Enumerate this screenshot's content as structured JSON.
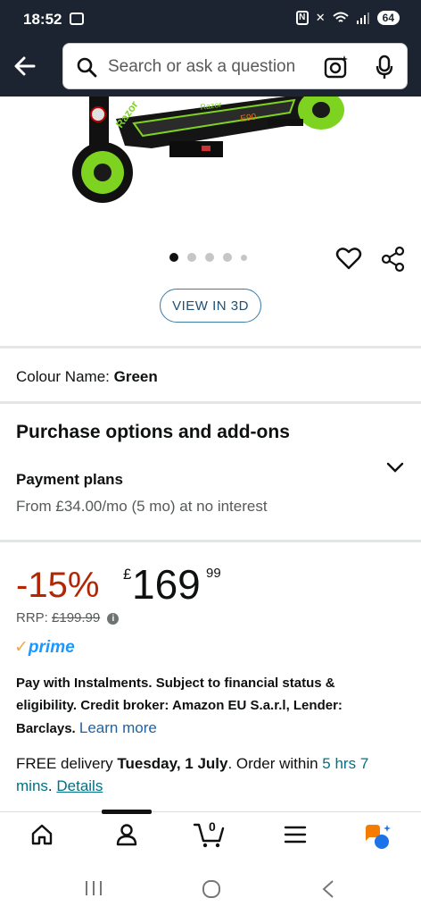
{
  "status": {
    "time": "18:52",
    "battery": "64"
  },
  "search": {
    "placeholder": "Search or ask a question"
  },
  "product": {
    "brand_text": "Razor",
    "button_view3d": "VIEW IN 3D",
    "colour_label": "Colour Name:",
    "colour_value": "Green"
  },
  "purchase": {
    "heading": "Purchase options and add-ons",
    "payment_title": "Payment plans",
    "payment_sub": "From £34.00/mo (5 mo) at no interest"
  },
  "price": {
    "discount": "-15%",
    "currency": "£",
    "whole": "169",
    "fraction": "99",
    "rrp_label": "RRP:",
    "rrp_value": "£199.99"
  },
  "prime": {
    "label": "prime"
  },
  "instalments": {
    "text": "Pay with Instalments. Subject to financial status & eligibility. Credit broker: Amazon EU S.a.r.l, Lender: Barclays.",
    "link": "Learn more"
  },
  "delivery": {
    "prefix": "FREE delivery",
    "date": "Tuesday, 1 July",
    "order_within": ". Order within",
    "countdown": "5 hrs 7 mins",
    "details_link": "Details"
  },
  "bottom_nav": {
    "cart_count": "0"
  },
  "colors": {
    "accent": "#007185",
    "discount": "#b12704",
    "header": "#1b2430",
    "prime": "#1a98ff"
  }
}
